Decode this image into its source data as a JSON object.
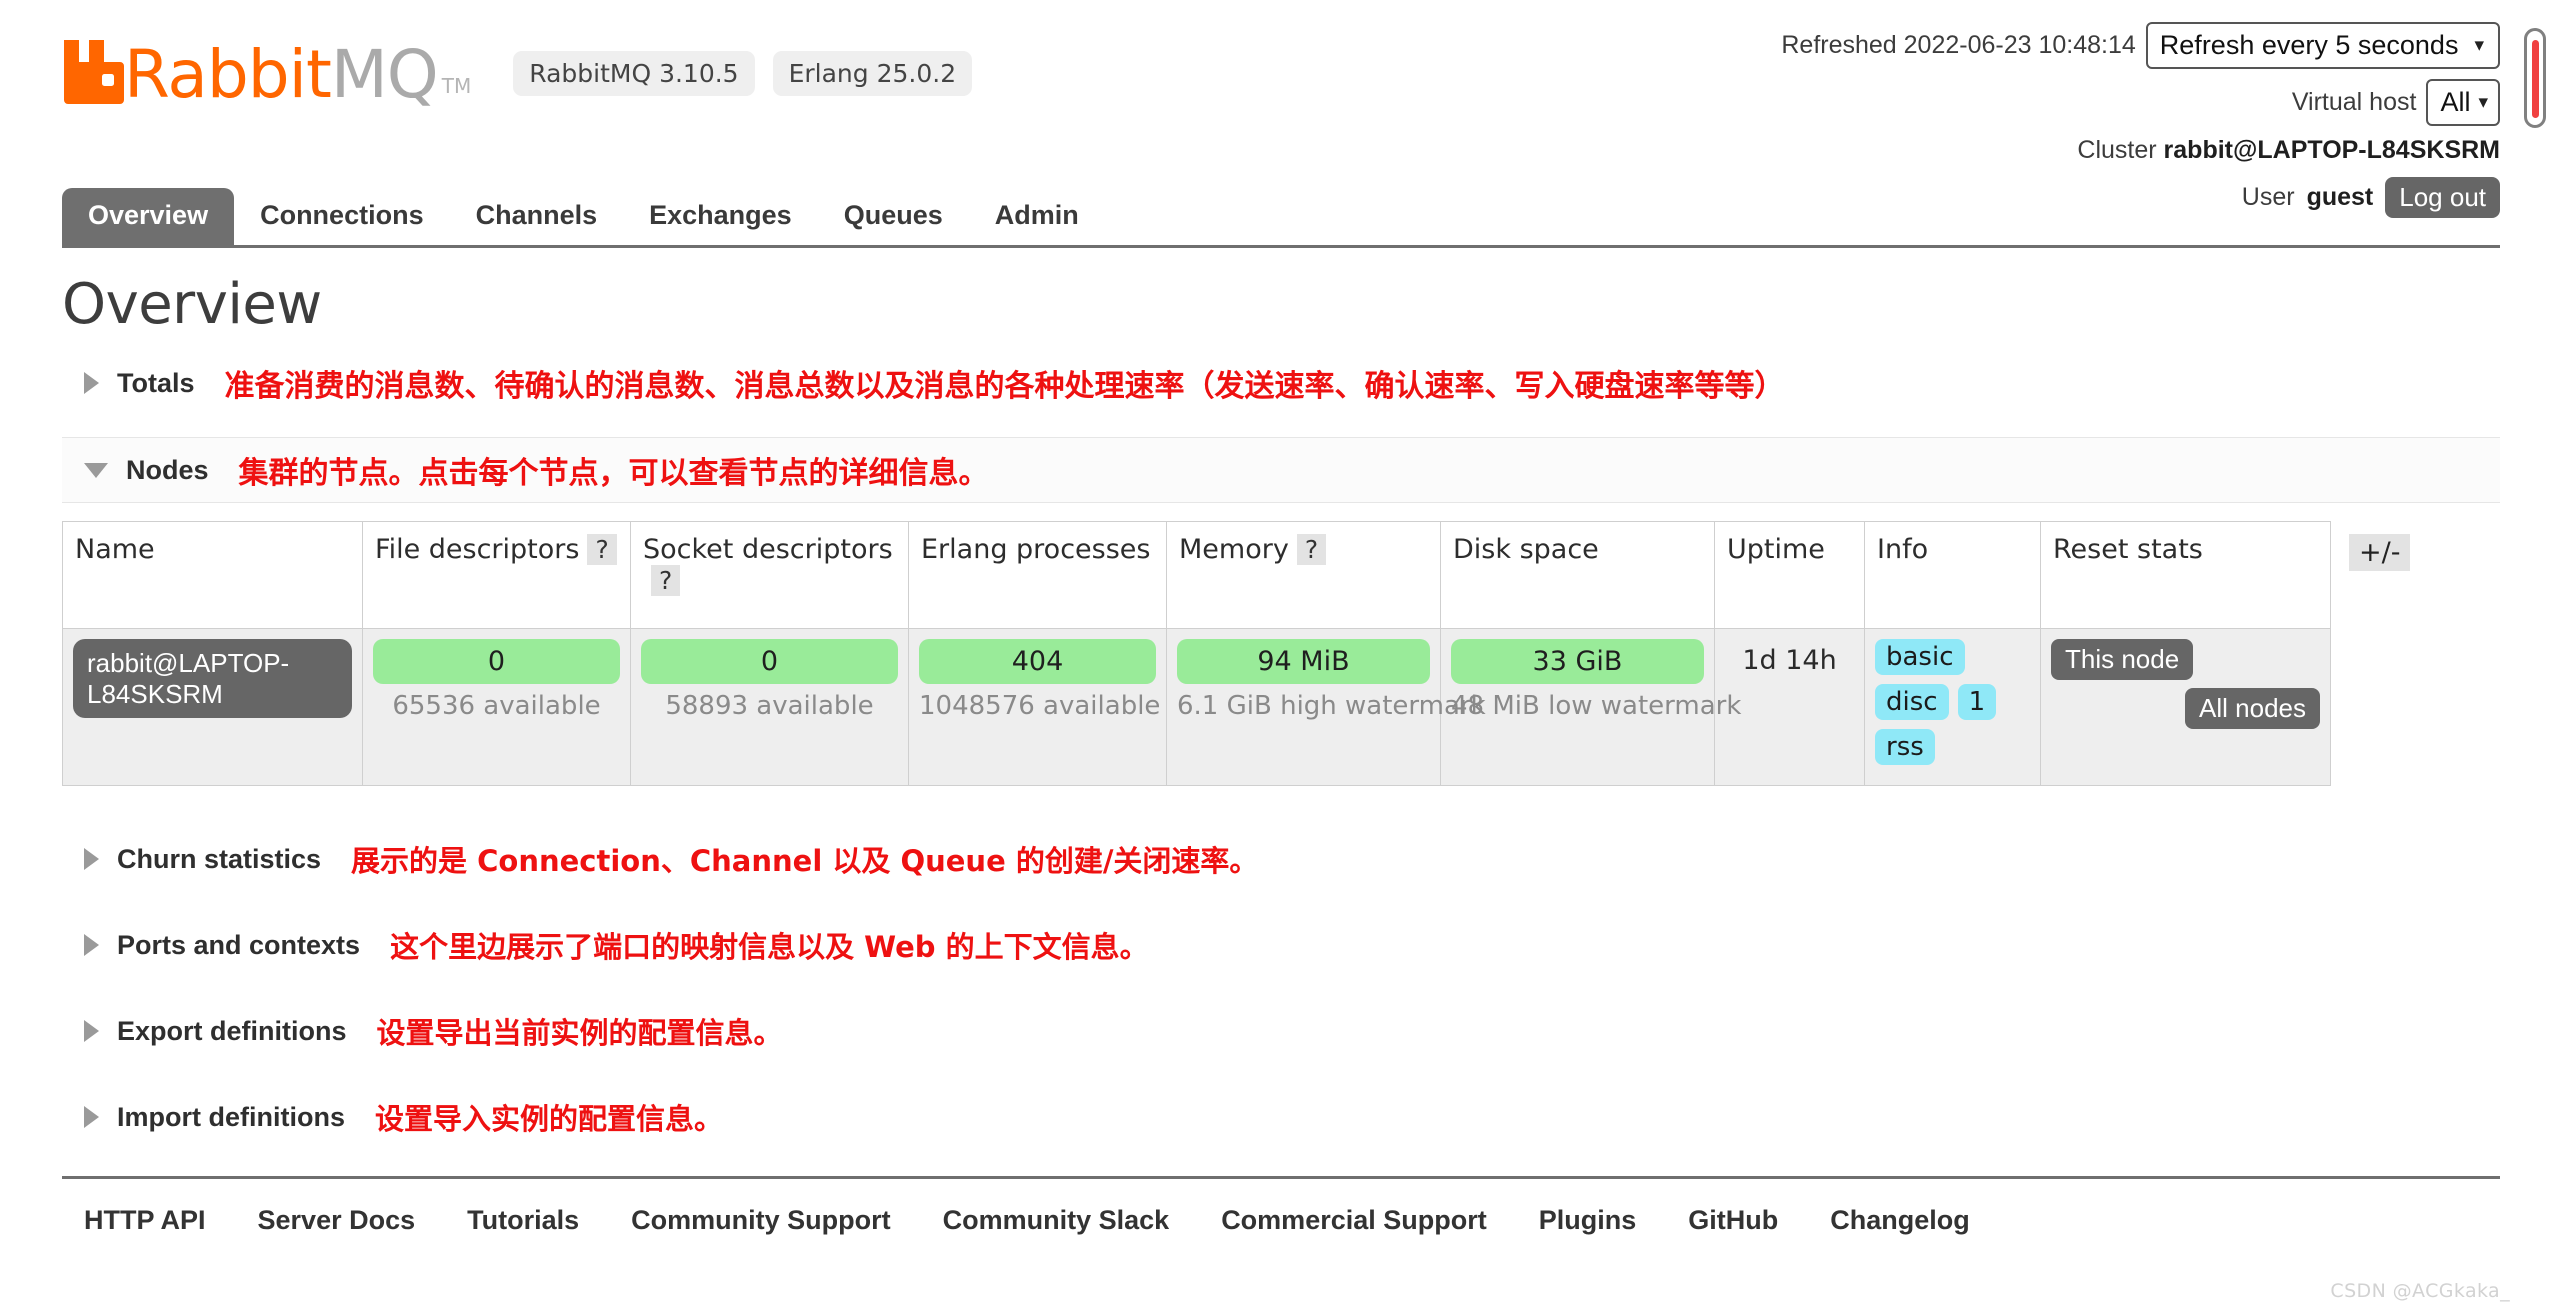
{
  "header": {
    "logo": {
      "part1": "Rabbit",
      "part2": "MQ",
      "tm": "TM",
      "color": "#ff6600"
    },
    "badges": [
      {
        "name": "rabbitmq-version-badge",
        "label": "RabbitMQ 3.10.5"
      },
      {
        "name": "erlang-version-badge",
        "label": "Erlang 25.0.2"
      }
    ],
    "refreshed_label": "Refreshed 2022-06-23 10:48:14",
    "refresh_select": {
      "value": "Refresh every 5 seconds"
    },
    "vhost_label": "Virtual host",
    "vhost_select": {
      "value": "All"
    },
    "cluster_label": "Cluster",
    "cluster_name": "rabbit@LAPTOP-L84SKSRM",
    "user_label": "User",
    "user_name": "guest",
    "logout_label": "Log out"
  },
  "nav": {
    "tabs": [
      {
        "label": "Overview",
        "active": true
      },
      {
        "label": "Connections",
        "active": false
      },
      {
        "label": "Channels",
        "active": false
      },
      {
        "label": "Exchanges",
        "active": false
      },
      {
        "label": "Queues",
        "active": false
      },
      {
        "label": "Admin",
        "active": false
      }
    ]
  },
  "main": {
    "title": "Overview",
    "totals": {
      "label": "Totals",
      "annotation": "准备消费的消息数、待确认的消息数、消息总数以及消息的各种处理速率（发送速率、确认速率、写入硬盘速率等等）"
    },
    "nodes": {
      "label": "Nodes",
      "annotation": "集群的节点。点击每个节点，可以查看节点的详细信息。",
      "columns": [
        "Name",
        "File descriptors",
        "Socket descriptors",
        "Erlang processes",
        "Memory",
        "Disk space",
        "Uptime",
        "Info",
        "Reset stats"
      ],
      "help_icon": "?",
      "plusminus_label": "+/-",
      "row": {
        "name": "rabbit@LAPTOP-L84SKSRM",
        "file_descriptors": {
          "value": "0",
          "sub": "65536 available"
        },
        "socket_descriptors": {
          "value": "0",
          "sub": "58893 available"
        },
        "erlang_processes": {
          "value": "404",
          "sub": "1048576 available"
        },
        "memory": {
          "value": "94 MiB",
          "sub": "6.1 GiB high watermark"
        },
        "disk_space": {
          "value": "33 GiB",
          "sub": "48 MiB low watermark"
        },
        "uptime": "1d 14h",
        "info_badges": [
          "basic",
          "disc",
          "1",
          "rss"
        ],
        "reset_buttons": [
          "This node",
          "All nodes"
        ]
      }
    },
    "sections": [
      {
        "label": "Churn statistics",
        "annotation": "展示的是 Connection、Channel 以及 Queue 的创建/关闭速率。"
      },
      {
        "label": "Ports and contexts",
        "annotation": "这个里边展示了端口的映射信息以及 Web 的上下文信息。"
      },
      {
        "label": "Export definitions",
        "annotation": "设置导出当前实例的配置信息。"
      },
      {
        "label": "Import definitions",
        "annotation": "设置导入实例的配置信息。"
      }
    ]
  },
  "footer": {
    "links": [
      "HTTP API",
      "Server Docs",
      "Tutorials",
      "Community Support",
      "Community Slack",
      "Commercial Support",
      "Plugins",
      "GitHub",
      "Changelog"
    ]
  },
  "watermark": "CSDN @ACGkaka_"
}
